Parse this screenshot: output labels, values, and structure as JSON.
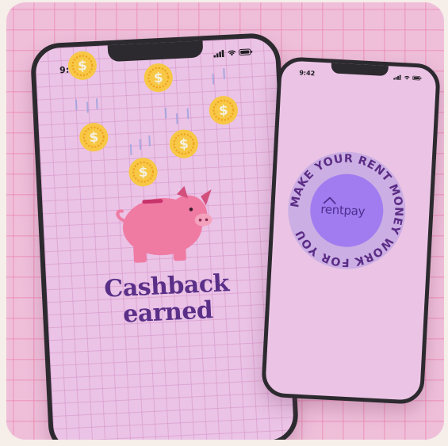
{
  "left_phone": {
    "status_time": "9:42",
    "headline_line1": "Cashback",
    "headline_line2": "earned",
    "coin_symbol": "$"
  },
  "right_phone": {
    "status_time": "9:42",
    "badge_text": "MAKE YOUR RENT MONEY WORK FOR YOU",
    "brand_name": "rentpay"
  },
  "colors": {
    "card_background": "#efbfda",
    "headline": "#5a2f88",
    "badge_outer": "#cbaee3",
    "badge_inner": "#a17cf0",
    "coin": "#f7c745",
    "pig": "#ef7ba3",
    "phone_frame": "#2c2a2f"
  },
  "icons": {
    "signal": "signal-bars-icon",
    "wifi": "wifi-icon",
    "battery": "battery-icon",
    "coin": "dollar-coin-icon",
    "pig": "piggy-bank-icon",
    "brand_house": "house-roof-icon"
  }
}
